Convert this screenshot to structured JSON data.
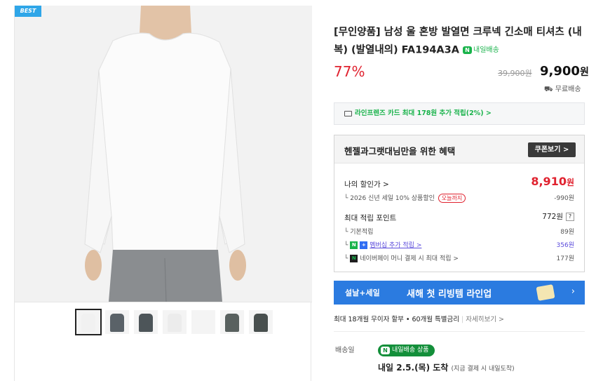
{
  "gallery": {
    "badge": "BEST",
    "thumb_colors": [
      "#f1f1f1",
      "#5a6268",
      "#4d5559",
      "#ececec",
      "#f4f4f4",
      "#59615f",
      "#484f4e"
    ]
  },
  "product": {
    "title": "[무인양품] 남성 울 혼방 발열면 크루넥 긴소매 티셔츠 (내복) (발열내의) FA194A3A",
    "delivery_badge": "내일배송",
    "discount": "77%",
    "original_price": "39,900원",
    "price": "9,900",
    "price_unit": "원",
    "shipping": "무료배송"
  },
  "card_offer": {
    "text": "라인프렌즈 카드 최대 178원 추가 적립(2%) >"
  },
  "benefit": {
    "title": "헨젤과그랫대님만을 위한 혜택",
    "coupon_button": "쿠폰보기 >",
    "my_price_label": "나의 할인가 >",
    "my_price": "8,910",
    "my_price_unit": "원",
    "sale_label": "2026 신년 세일 10% 상품할인",
    "sale_tag": "오늘까지",
    "sale_amount": "-990원",
    "points_label": "최대 적립 포인트",
    "points_total": "772원",
    "points_help": "?",
    "basic_label": "기본적립",
    "basic_value": "89원",
    "membership_label": "멤버십 추가 적립 >",
    "membership_value": "356원",
    "naverpay_label": "네이버페이 머니 결제 시 최대 적립 >",
    "naverpay_value": "177원"
  },
  "banner": {
    "left": "설날+세일",
    "main": "새해 첫 리빙템 라인업",
    "chevron": "›"
  },
  "installment": {
    "text": "최대 18개월 무이자 할부 • 60개월 특별금리",
    "more": "자세히보기 >"
  },
  "delivery": {
    "label": "배송일",
    "badge": "내일배송 상품",
    "arrival": "내일 2.5.(목) 도착",
    "arrival_note": "(지금 결제 시 내일도착)"
  },
  "colors": {
    "accent_green": "#19b34b",
    "price_red": "#e0222f",
    "banner_blue": "#2b7be0"
  }
}
